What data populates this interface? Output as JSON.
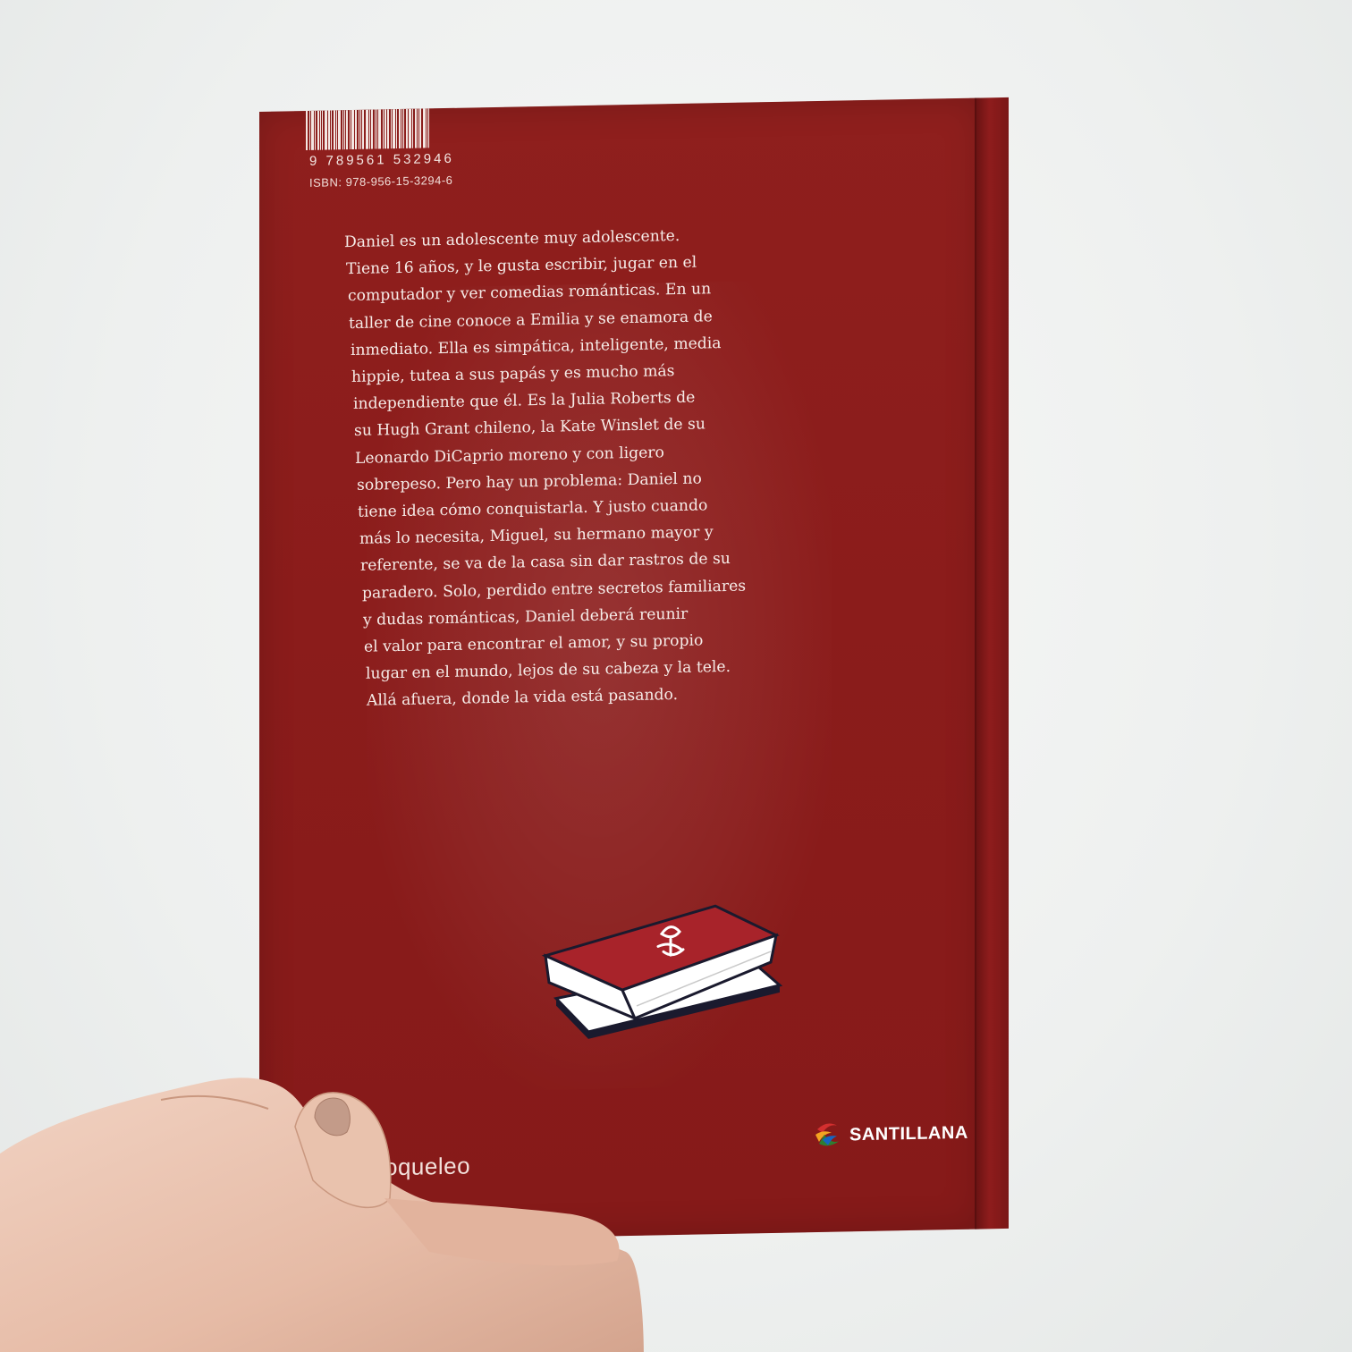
{
  "barcode": {
    "digits": "9 789561 532946",
    "isbn": "ISBN: 978-956-15-3294-6"
  },
  "blurb": {
    "lines": [
      "Daniel es un adolescente muy adolescente.",
      "Tiene 16 años, y le gusta escribir, jugar en el",
      "computador y ver comedias románticas. En un",
      "taller de cine conoce a Emilia y se enamora de",
      "inmediato. Ella es simpática, inteligente, media",
      "hippie, tutea a sus papás y es mucho más",
      "independiente que él. Es la Julia Roberts de",
      "su Hugh Grant chileno, la Kate Winslet de su",
      "Leonardo DiCaprio moreno y con ligero",
      "sobrepeso. Pero hay un problema: Daniel no",
      "tiene idea cómo conquistarla. Y justo cuando",
      "más lo necesita, Miguel, su hermano mayor y",
      "referente, se va de la casa sin dar rastros de su",
      "paradero. Solo, perdido entre secretos familiares",
      "y dudas románticas, Daniel deberá reunir",
      "el valor para encontrar el amor, y su propio",
      "lugar en el mundo, lejos de su cabeza y la tele.",
      "Allá afuera, donde la vida está pasando."
    ]
  },
  "logos": {
    "publisher_imprint": "oqueleo",
    "publisher": "SANTILLANA"
  },
  "icons": {
    "books_illustration": "stacked-books-icon",
    "santillana_mark": "santillana-logo-icon"
  },
  "colors": {
    "cover_red": "#8b1c1b",
    "text": "#f6ece8",
    "wall": "#eef1f0"
  }
}
